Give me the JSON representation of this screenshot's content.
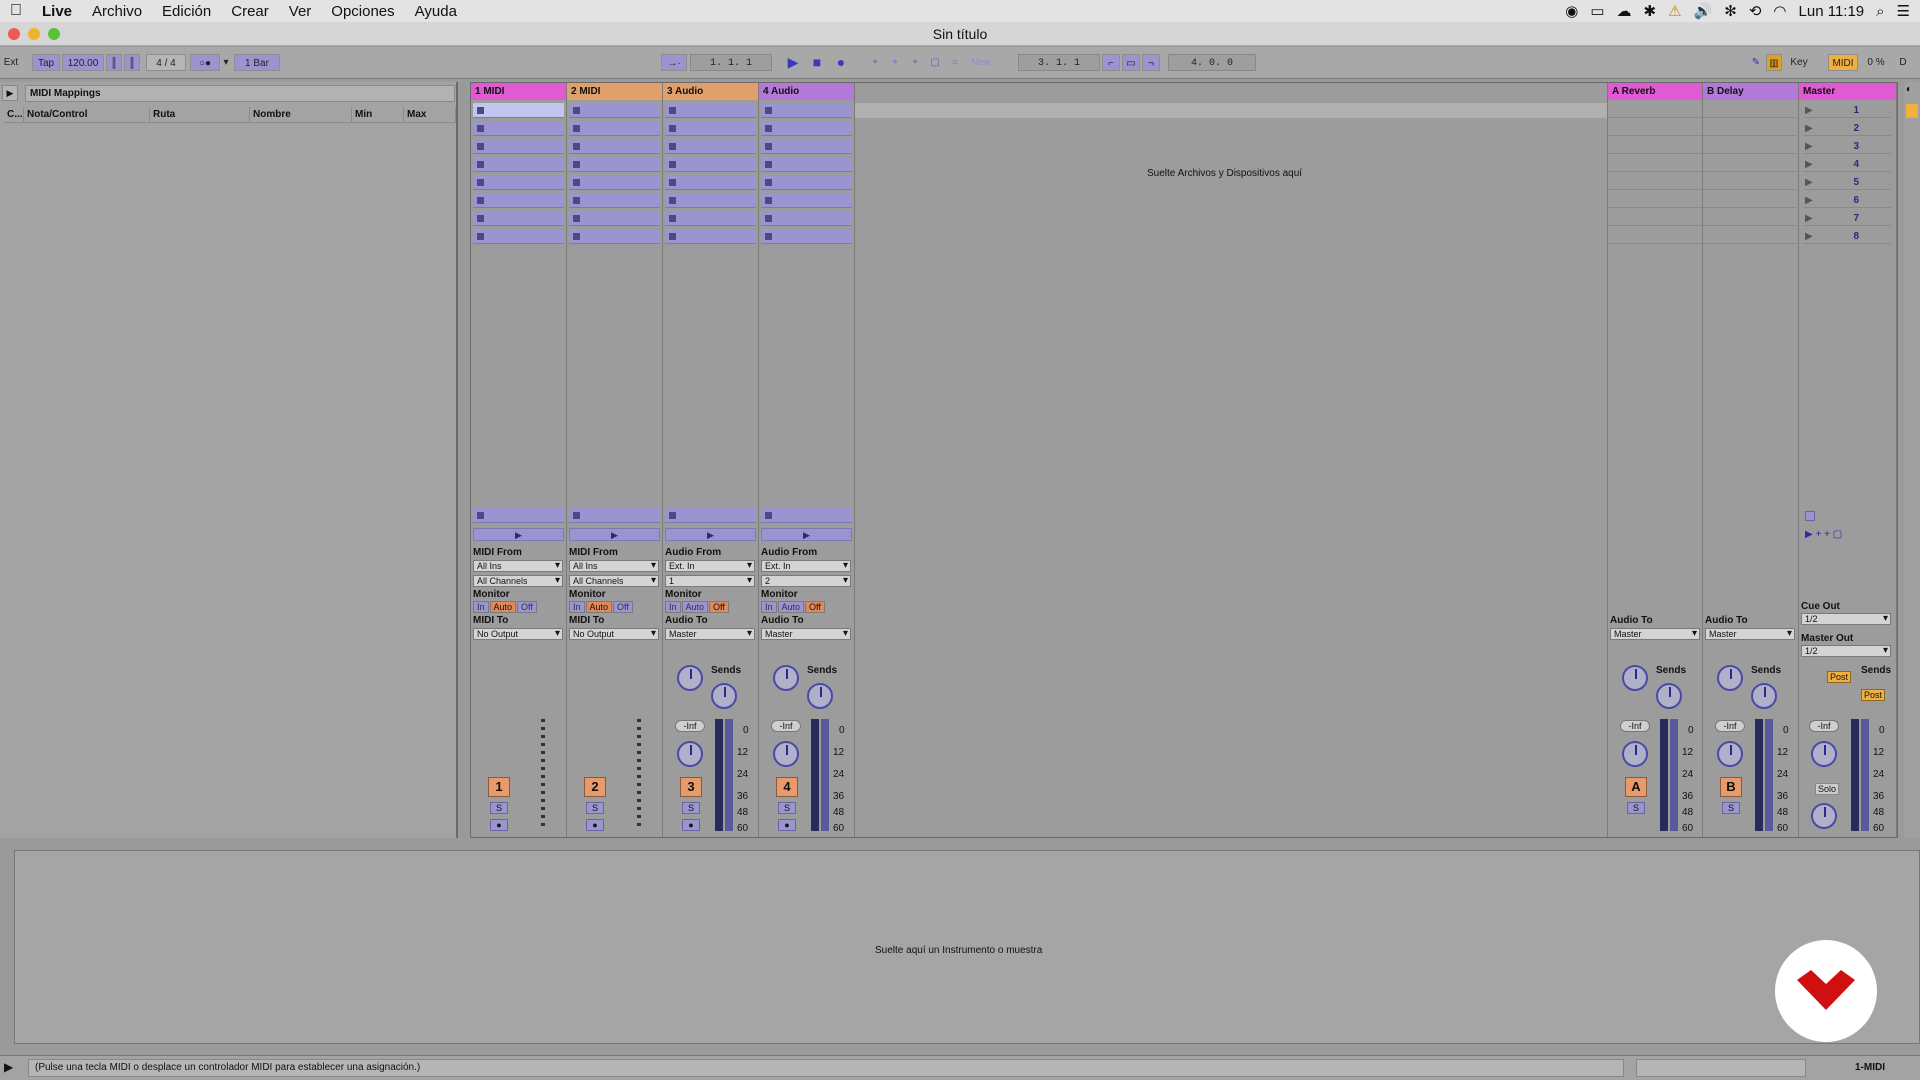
{
  "menubar": {
    "items": [
      "Live",
      "Archivo",
      "Edición",
      "Crear",
      "Ver",
      "Opciones",
      "Ayuda"
    ],
    "clock": "Lun 11:19"
  },
  "window": {
    "title": "Sin título"
  },
  "control": {
    "ext": "Ext",
    "tap": "Tap",
    "tempo": "120.00",
    "signature": "4 / 4",
    "quantize": "1 Bar",
    "arrangement_pos": "1.  1.  1",
    "new_label": "New",
    "loop_start": "3.  1.  1",
    "loop_length": "4.  0.  0",
    "key_label": "Key",
    "midi_label": "MIDI",
    "cpu": "0 %",
    "d_label": "D"
  },
  "browser": {
    "title": "MIDI Mappings",
    "columns": [
      "C...",
      "Nota/Control",
      "Ruta",
      "Nombre",
      "Min",
      "Max"
    ]
  },
  "tracks": [
    {
      "name": "1 MIDI",
      "color": "#e05ad4",
      "io_from_label": "MIDI From",
      "from": "All Ins",
      "channel": "All Channels",
      "to_label": "MIDI To",
      "to": "No Output",
      "number": "1"
    },
    {
      "name": "2 MIDI",
      "color": "#e0a06a",
      "io_from_label": "MIDI From",
      "from": "All Ins",
      "channel": "All Channels",
      "to_label": "MIDI To",
      "to": "No Output",
      "number": "2"
    },
    {
      "name": "3 Audio",
      "color": "#e0a06a",
      "io_from_label": "Audio From",
      "from": "Ext. In",
      "channel": "1",
      "to_label": "Audio To",
      "to": "Master",
      "number": "3"
    },
    {
      "name": "4 Audio",
      "color": "#b478d8",
      "io_from_label": "Audio From",
      "from": "Ext. In",
      "channel": "2",
      "to_label": "Audio To",
      "to": "Master",
      "number": "4"
    }
  ],
  "returns": [
    {
      "name": "A Reverb",
      "color": "#e05ad4",
      "to_label": "Audio To",
      "to": "Master",
      "letter": "A"
    },
    {
      "name": "B Delay",
      "color": "#b478d8",
      "to_label": "Audio To",
      "to": "Master",
      "letter": "B"
    }
  ],
  "master": {
    "name": "Master",
    "color": "#e05ad4",
    "scenes": [
      "1",
      "2",
      "3",
      "4",
      "5",
      "6",
      "7",
      "8"
    ],
    "cue_label": "Cue Out",
    "cue": "1/2",
    "out_label": "Master Out",
    "out": "1/2",
    "solo": "Solo",
    "post": "Post"
  },
  "mixer": {
    "monitor_label": "Monitor",
    "mon_in": "In",
    "mon_auto": "Auto",
    "mon_off": "Off",
    "sends_label": "Sends",
    "vol": "-Inf",
    "solo_s": "S",
    "db_ticks": [
      "0",
      "12",
      "24",
      "36",
      "48",
      "60"
    ]
  },
  "drop_files": "Suelte Archivos y Dispositivos aquí",
  "detail_drop": "Suelte aquí un Instrumento o muestra",
  "status": {
    "message": "(Pulse una tecla MIDI o desplace un controlador MIDI para establecer una asignación.)",
    "track": "1-MIDI"
  }
}
